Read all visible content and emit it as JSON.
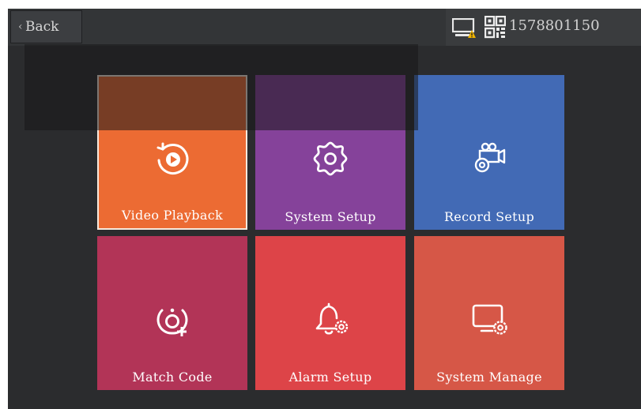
{
  "header": {
    "back_label": "Back",
    "device_id": "1578801150"
  },
  "menu": {
    "tiles": [
      {
        "label": "Video Playback",
        "icon": "replay-play-icon",
        "color": "#ec6b33",
        "selected": true
      },
      {
        "label": "System Setup",
        "icon": "gear-icon",
        "color": "#85429a",
        "selected": false
      },
      {
        "label": "Record Setup",
        "icon": "camera-settings-icon",
        "color": "#426ab5",
        "selected": false
      },
      {
        "label": "Match Code",
        "icon": "match-add-icon",
        "color": "#b23457",
        "selected": false
      },
      {
        "label": "Alarm Setup",
        "icon": "bell-settings-icon",
        "color": "#dd4448",
        "selected": false
      },
      {
        "label": "System Manage",
        "icon": "monitor-settings-icon",
        "color": "#d65747",
        "selected": false
      }
    ]
  },
  "status_icons": [
    "monitor-warning-icon",
    "qr-code-icon"
  ]
}
